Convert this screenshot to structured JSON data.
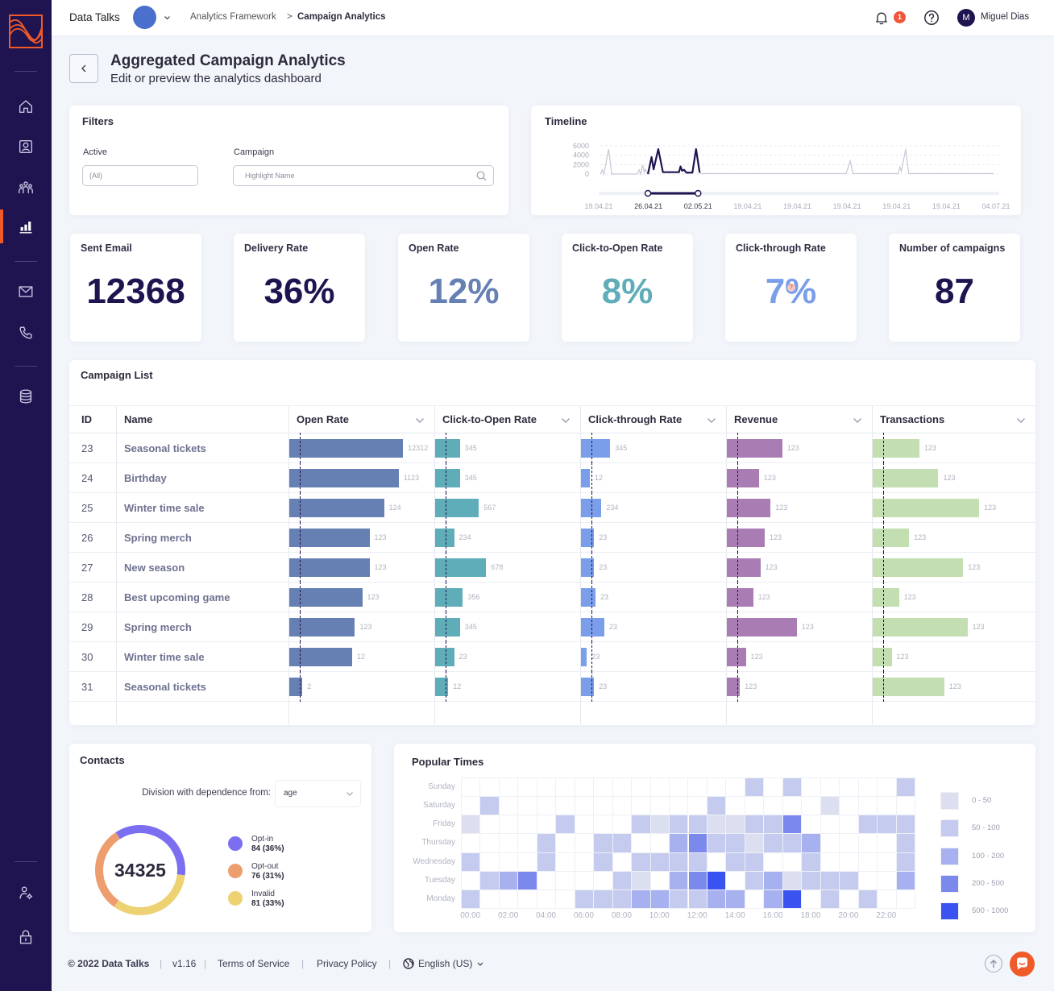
{
  "app": {
    "name": "Data Talks",
    "workspace_color": "#4a6fcc"
  },
  "breadcrumb": {
    "parent": "Analytics Framework",
    "separator": ">",
    "current": "Campaign Analytics"
  },
  "header": {
    "notification_count": "1",
    "user_initial": "M",
    "user_name": "Miguel Dias"
  },
  "sidebar": {
    "items": [
      {
        "key": "home",
        "icon": "home-icon"
      },
      {
        "key": "contacts",
        "icon": "contact-card-icon"
      },
      {
        "key": "audiences",
        "icon": "users-group-icon"
      },
      {
        "key": "analytics",
        "icon": "bar-chart-icon",
        "active": true
      },
      {
        "key": "email",
        "icon": "mail-icon"
      },
      {
        "key": "phone",
        "icon": "phone-icon"
      },
      {
        "key": "database",
        "icon": "database-icon"
      },
      {
        "key": "user-settings",
        "icon": "user-settings-icon"
      },
      {
        "key": "security",
        "icon": "lock-icon"
      }
    ]
  },
  "page": {
    "title": "Aggregated Campaign Analytics",
    "subtitle": "Edit or preview the analytics dashboard"
  },
  "filters": {
    "title": "Filters",
    "active_label": "Active",
    "active_value": "(All)",
    "campaign_label": "Campaign",
    "campaign_placeholder": "Highlight Name"
  },
  "kpis": [
    {
      "label": "Sent Email",
      "value": "12368",
      "color": "#1f1450"
    },
    {
      "label": "Delivery Rate",
      "value": "36%",
      "color": "#1f1450"
    },
    {
      "label": "Open Rate",
      "value": "12%",
      "color": "#6680b3"
    },
    {
      "label": "Click-to-Open Rate",
      "value": "8%",
      "color": "#5fadb8"
    },
    {
      "label": "Click-through Rate",
      "value": "7%",
      "color": "#7a9eea",
      "marker": "help-marker-icon"
    },
    {
      "label": "Number of campaigns",
      "value": "87",
      "color": "#1f1450"
    }
  ],
  "campaign_list": {
    "title": "Campaign List",
    "id_header": "ID",
    "name_header": "Name",
    "reference_marker_pct": 7,
    "metrics": [
      {
        "key": "open",
        "label": "Open Rate",
        "color": "#6680b3"
      },
      {
        "key": "ctor",
        "label": "Click-to-Open Rate",
        "color": "#5fadb8"
      },
      {
        "key": "ctr",
        "label": "Click-through Rate",
        "color": "#7a9eea"
      },
      {
        "key": "revenue",
        "label": "Revenue",
        "color": "#a97db3"
      },
      {
        "key": "transactions",
        "label": "Transactions",
        "color": "#c3deb0"
      }
    ],
    "rows": [
      {
        "id": "23",
        "name": "Seasonal tickets",
        "cells": [
          {
            "label": "12312",
            "fill_pct": 78
          },
          {
            "label": "345",
            "fill_pct": 17
          },
          {
            "label": "345",
            "fill_pct": 20
          },
          {
            "label": "123",
            "fill_pct": 38
          },
          {
            "label": "123",
            "fill_pct": 32
          }
        ]
      },
      {
        "id": "24",
        "name": "Birthday",
        "cells": [
          {
            "label": "1123",
            "fill_pct": 75
          },
          {
            "label": "345",
            "fill_pct": 17
          },
          {
            "label": "12",
            "fill_pct": 6
          },
          {
            "label": "123",
            "fill_pct": 22
          },
          {
            "label": "123",
            "fill_pct": 45
          }
        ]
      },
      {
        "id": "25",
        "name": "Winter time sale",
        "cells": [
          {
            "label": "124",
            "fill_pct": 65
          },
          {
            "label": "567",
            "fill_pct": 30
          },
          {
            "label": "234",
            "fill_pct": 14
          },
          {
            "label": "123",
            "fill_pct": 30
          },
          {
            "label": "123",
            "fill_pct": 73
          }
        ]
      },
      {
        "id": "26",
        "name": "Spring merch",
        "cells": [
          {
            "label": "123",
            "fill_pct": 55
          },
          {
            "label": "234",
            "fill_pct": 13
          },
          {
            "label": "23",
            "fill_pct": 9
          },
          {
            "label": "123",
            "fill_pct": 26
          },
          {
            "label": "123",
            "fill_pct": 25
          }
        ]
      },
      {
        "id": "27",
        "name": "New season",
        "cells": [
          {
            "label": "123",
            "fill_pct": 55
          },
          {
            "label": "678",
            "fill_pct": 35
          },
          {
            "label": "23",
            "fill_pct": 9
          },
          {
            "label": "123",
            "fill_pct": 23
          },
          {
            "label": "123",
            "fill_pct": 62
          }
        ]
      },
      {
        "id": "28",
        "name": "Best upcoming game",
        "cells": [
          {
            "label": "123",
            "fill_pct": 50
          },
          {
            "label": "356",
            "fill_pct": 19
          },
          {
            "label": "23",
            "fill_pct": 10
          },
          {
            "label": "123",
            "fill_pct": 18
          },
          {
            "label": "123",
            "fill_pct": 18
          }
        ]
      },
      {
        "id": "29",
        "name": "Spring merch",
        "cells": [
          {
            "label": "123",
            "fill_pct": 45
          },
          {
            "label": "345",
            "fill_pct": 17
          },
          {
            "label": "23",
            "fill_pct": 16
          },
          {
            "label": "123",
            "fill_pct": 48
          },
          {
            "label": "123",
            "fill_pct": 65
          }
        ]
      },
      {
        "id": "30",
        "name": "Winter time sale",
        "cells": [
          {
            "label": "12",
            "fill_pct": 43
          },
          {
            "label": "23",
            "fill_pct": 13
          },
          {
            "label": "23",
            "fill_pct": 4
          },
          {
            "label": "123",
            "fill_pct": 13
          },
          {
            "label": "123",
            "fill_pct": 13
          }
        ]
      },
      {
        "id": "31",
        "name": "Seasonal tickets",
        "cells": [
          {
            "label": "2",
            "fill_pct": 9
          },
          {
            "label": "12",
            "fill_pct": 9
          },
          {
            "label": "23",
            "fill_pct": 9
          },
          {
            "label": "123",
            "fill_pct": 9
          },
          {
            "label": "123",
            "fill_pct": 49
          }
        ]
      }
    ]
  },
  "contacts": {
    "title": "Contacts",
    "division_label": "Division with dependence from:",
    "division_value": "age"
  },
  "popular_times": {
    "title": "Popular Times"
  },
  "chart_data": [
    {
      "type": "line",
      "title": "Timeline",
      "ylim": [
        0,
        6000
      ],
      "yticks": [
        "6000",
        "4000",
        "2000",
        "0"
      ],
      "ytick_values": [
        6000,
        4000,
        2000,
        0
      ],
      "grid": true,
      "x_unit": "days since 19.04.21",
      "x_range": [
        0,
        76
      ],
      "x_tick_labels": [
        "19.04.21",
        "26.04.21",
        "02.05.21",
        "19.04.21",
        "19.04.21",
        "19.04.21",
        "19.04.21",
        "19.04.21",
        "04.07.21"
      ],
      "selected_tick_indices": [
        1,
        2
      ],
      "selected_range": [
        9.2,
        19.2
      ],
      "line_color": "#c9c7d6",
      "selected_color": "#1f1450",
      "points": [
        [
          0,
          0
        ],
        [
          0.4,
          900
        ],
        [
          0.7,
          0
        ],
        [
          1.6,
          5300
        ],
        [
          2.2,
          0
        ],
        [
          7.1,
          0
        ],
        [
          7.5,
          900
        ],
        [
          7.8,
          0
        ],
        [
          8.2,
          1900
        ],
        [
          8.5,
          400
        ],
        [
          8.7,
          1000
        ],
        [
          9.2,
          0
        ],
        [
          9.9,
          3600
        ],
        [
          10.3,
          1000
        ],
        [
          11.2,
          5300
        ],
        [
          12.1,
          400
        ],
        [
          15.2,
          400
        ],
        [
          15.5,
          1600
        ],
        [
          15.8,
          700
        ],
        [
          16.2,
          900
        ],
        [
          16.6,
          300
        ],
        [
          17.8,
          300
        ],
        [
          18.5,
          5300
        ],
        [
          19.2,
          300
        ],
        [
          19.5,
          100
        ],
        [
          47.5,
          100
        ],
        [
          48.3,
          2800
        ],
        [
          48.8,
          100
        ],
        [
          57.6,
          100
        ],
        [
          57.9,
          1500
        ],
        [
          58.2,
          600
        ],
        [
          59.0,
          5300
        ],
        [
          59.6,
          100
        ],
        [
          76,
          100
        ]
      ]
    },
    {
      "type": "pie",
      "title": "Contacts",
      "total": "34325",
      "slices": [
        {
          "label": "Opt-in",
          "count": 84,
          "pct": 36,
          "display": "84 (36%)",
          "color": "#7b6ef0"
        },
        {
          "label": "Opt-out",
          "count": 76,
          "pct": 31,
          "display": "76 (31%)",
          "color": "#ee9d6f"
        },
        {
          "label": "Invalid",
          "count": 81,
          "pct": 33,
          "display": "81 (33%)",
          "color": "#ecd272"
        }
      ]
    },
    {
      "type": "heatmap",
      "title": "Popular Times",
      "rows": [
        "Sunday",
        "Saturday",
        "Friday",
        "Thursday",
        "Wednesday",
        "Tuesday",
        "Monday"
      ],
      "hours_per_row": 24,
      "x_tick_labels": [
        "00:00",
        "02:00",
        "04:00",
        "06:00",
        "08:00",
        "10:00",
        "12:00",
        "14:00",
        "16:00",
        "18:00",
        "20:00",
        "22:00"
      ],
      "bins": [
        {
          "label": "0 - 50",
          "color": "#dcdff0"
        },
        {
          "label": "50 - 100",
          "color": "#c5cbee"
        },
        {
          "label": "100 - 200",
          "color": "#a7b1ef"
        },
        {
          "label": "200 - 500",
          "color": "#7b89ed"
        },
        {
          "label": "500 - 1000",
          "color": "#3a52ef"
        }
      ],
      "values_note": "bin index per hour, null = no data",
      "values": [
        [
          null,
          null,
          null,
          null,
          null,
          null,
          null,
          null,
          null,
          null,
          null,
          null,
          null,
          null,
          null,
          1,
          null,
          1,
          null,
          null,
          null,
          null,
          null,
          1
        ],
        [
          null,
          1,
          null,
          null,
          null,
          null,
          null,
          null,
          null,
          null,
          null,
          null,
          null,
          1,
          null,
          null,
          null,
          null,
          null,
          0,
          null,
          null,
          null,
          null
        ],
        [
          0,
          null,
          null,
          null,
          null,
          1,
          null,
          null,
          null,
          1,
          0,
          1,
          1,
          0,
          0,
          1,
          1,
          3,
          null,
          null,
          null,
          1,
          1,
          1
        ],
        [
          null,
          null,
          null,
          null,
          1,
          null,
          null,
          1,
          1,
          null,
          null,
          2,
          3,
          1,
          1,
          0,
          1,
          1,
          2,
          null,
          null,
          null,
          null,
          1
        ],
        [
          1,
          null,
          null,
          null,
          1,
          null,
          null,
          1,
          null,
          1,
          1,
          1,
          1,
          null,
          1,
          1,
          null,
          null,
          1,
          null,
          null,
          null,
          null,
          1
        ],
        [
          null,
          1,
          2,
          3,
          null,
          null,
          null,
          null,
          1,
          0,
          null,
          2,
          3,
          4,
          null,
          1,
          2,
          0,
          1,
          1,
          1,
          null,
          null,
          2
        ],
        [
          1,
          null,
          null,
          null,
          null,
          null,
          1,
          1,
          1,
          2,
          2,
          1,
          1,
          2,
          2,
          null,
          2,
          4,
          null,
          1,
          null,
          1,
          null,
          null
        ]
      ]
    }
  ],
  "footer": {
    "copyright": "© 2022 Data Talks",
    "separator": "|",
    "version": "v1.16",
    "terms": "Terms of Service",
    "privacy": "Privacy Policy",
    "language": "English (US)"
  }
}
